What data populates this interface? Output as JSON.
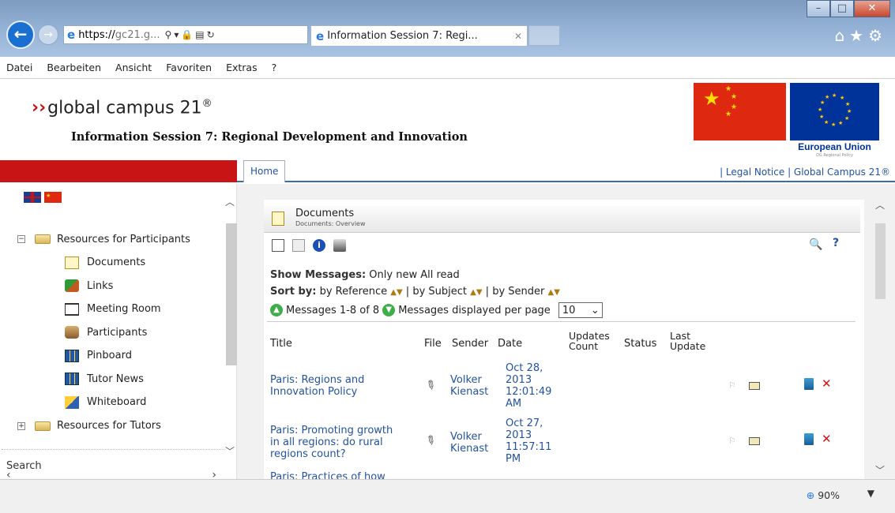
{
  "browser": {
    "url_host": "https://",
    "url_rest": "gc21.g...",
    "tab_title": "Information Session 7: Regi...",
    "back_icon": "arrow-left",
    "menus": [
      "Datei",
      "Bearbeiten",
      "Ansicht",
      "Favoriten",
      "Extras",
      "?"
    ],
    "zoom": "90%"
  },
  "site": {
    "logo_text": "global campus 21",
    "logo_mark": "®",
    "session_title": "Information Session 7: Regional Development and Innovation",
    "eu_label": "European Union",
    "eu_sub": "DG Regional Policy",
    "home_tab": "Home",
    "top_links": "| Legal Notice | Global Campus 21®"
  },
  "sidebar": {
    "group1": "Resources for Participants",
    "items": [
      "Documents",
      "Links",
      "Meeting Room",
      "Participants",
      "Pinboard",
      "Tutor News",
      "Whiteboard"
    ],
    "group2": "Resources for Tutors",
    "search_label": "Search"
  },
  "panel": {
    "title": "Documents",
    "subtitle": "Documents: Overview",
    "show_messages_label": "Show Messages:",
    "show_only_new": "Only new",
    "show_all_read": "All read",
    "sort_by_label": "Sort by:",
    "sort_reference": "by Reference",
    "sort_subject": "by Subject",
    "sort_sender": "by Sender",
    "messages_range": "Messages 1-8 of 8",
    "per_page_label": "Messages displayed per page",
    "per_page_value": "10",
    "columns": {
      "title": "Title",
      "file": "File",
      "sender": "Sender",
      "date": "Date",
      "updates_1": "Updates",
      "updates_2": "Count",
      "status": "Status",
      "last_1": "Last",
      "last_2": "Update"
    },
    "rows": [
      {
        "title_1": "Paris: Regions and",
        "title_2": "Innovation Policy",
        "title_3": "",
        "sender_1": "Volker",
        "sender_2": "Kienast",
        "date_1": "Oct 28,",
        "date_2": "2013",
        "date_3": "12:01:49",
        "date_4": "AM"
      },
      {
        "title_1": "Paris: Promoting growth",
        "title_2": "in all regions: do rural",
        "title_3": "regions count?",
        "sender_1": "Volker",
        "sender_2": "Kienast",
        "date_1": "Oct 27,",
        "date_2": "2013",
        "date_3": "11:57:11",
        "date_4": "PM"
      }
    ],
    "partial_row_title": "Paris: Practices of how"
  }
}
